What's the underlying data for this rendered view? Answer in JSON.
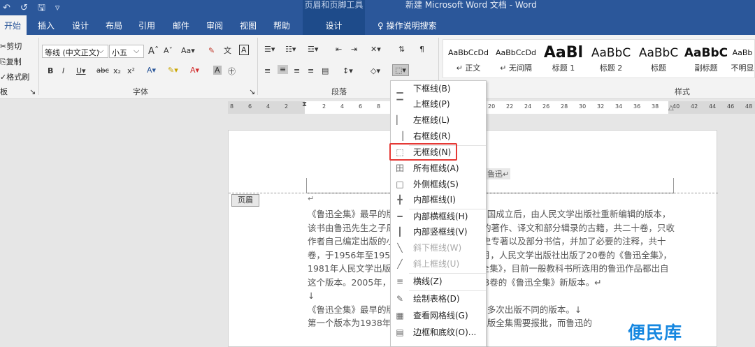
{
  "window": {
    "quick_access": [
      "↶",
      "↺",
      "🖫",
      "▿"
    ],
    "context_title": "页眉和页脚工具",
    "doc_title": "新建 Microsoft Word 文档 - Word"
  },
  "tabs": [
    "开始",
    "插入",
    "设计",
    "布局",
    "引用",
    "邮件",
    "审阅",
    "视图",
    "帮助"
  ],
  "context_tab": "设计",
  "tell_me": "操作说明搜索",
  "clipboard": {
    "cut": "剪切",
    "copy": "复制",
    "painter": "格式刷",
    "label": "板"
  },
  "font": {
    "name": "等线 (中文正文)",
    "size": "小五",
    "label": "字体"
  },
  "paragraph": {
    "label": "段落"
  },
  "styles": {
    "label": "样式",
    "items": [
      {
        "preview": "AaBbCcDd",
        "name": "↵ 正文"
      },
      {
        "preview": "AaBbCcDd",
        "name": "↵ 无间隔"
      },
      {
        "preview": "AaBl",
        "name": "标题 1"
      },
      {
        "preview": "AaBbC",
        "name": "标题 2"
      },
      {
        "preview": "AaBbC",
        "name": "标题"
      },
      {
        "preview": "AaBbC",
        "name": "副标题"
      },
      {
        "preview": "AaBb",
        "name": "不明显"
      }
    ]
  },
  "ruler_numbers": [
    "8",
    "6",
    "4",
    "2",
    "2",
    "4",
    "6",
    "8",
    "20",
    "22",
    "24",
    "26",
    "28",
    "30",
    "32",
    "34",
    "36",
    "38",
    "40",
    "42",
    "44",
    "46",
    "48"
  ],
  "header": {
    "tag": "页眉",
    "header_text": "鲁迅↵",
    "return_mark": "↵"
  },
  "body_paragraphs": [
    "《鲁迅全集》最早的版本为1938年版本。新中国成立后，由人民文学出版社重新编辑的版本，该书由鲁迅先生之子周海婴主编。这只是鲁迅的著作、译文和部分辑录的古籍，共二十卷，只收作者自己编定出版的小说、杂文、评论、文学史专著以及部分书信，并加了必要的注释，共十卷，于1956年至1958年间印行。1973年12月，人民文学出版社出版了20卷的《鲁迅全集》，1981年人民文学出版社出版了16卷的《鲁迅全集》，目前一般教科书所选用的鲁迅作品都出自这个版本。2005年，人民文学出版社出版了18卷的《鲁迅全集》新版本。↵",
    "↓",
    "《鲁迅全集》最早的版本为1938年版本，其后多次出版不同的版本。↓",
    "第一个版本为1938年版本，由于国家体制，出版全集需要报批，而鲁迅的"
  ],
  "border_menu": [
    {
      "glyph": "▁",
      "label": "下框线(B)",
      "disabled": false
    },
    {
      "glyph": "▔",
      "label": "上框线(P)",
      "disabled": false
    },
    {
      "glyph": "▏",
      "label": "左框线(L)",
      "disabled": false
    },
    {
      "glyph": "▕",
      "label": "右框线(R)",
      "disabled": false
    },
    {
      "glyph": "⬚",
      "label": "无框线(N)",
      "disabled": false
    },
    {
      "glyph": "田",
      "label": "所有框线(A)",
      "disabled": false
    },
    {
      "glyph": "□",
      "label": "外侧框线(S)",
      "disabled": false
    },
    {
      "glyph": "╋",
      "label": "内部框线(I)",
      "disabled": false
    },
    {
      "glyph": "━",
      "label": "内部横框线(H)",
      "disabled": false
    },
    {
      "glyph": "┃",
      "label": "内部竖框线(V)",
      "disabled": false
    },
    {
      "glyph": "╲",
      "label": "斜下框线(W)",
      "disabled": true
    },
    {
      "glyph": "╱",
      "label": "斜上框线(U)",
      "disabled": true
    },
    {
      "glyph": "≡",
      "label": "横线(Z)",
      "disabled": false
    },
    {
      "glyph": "✎",
      "label": "绘制表格(D)",
      "disabled": false
    },
    {
      "glyph": "▦",
      "label": "查看网格线(G)",
      "disabled": false
    },
    {
      "glyph": "▤",
      "label": "边框和底纹(O)...",
      "disabled": false
    }
  ],
  "highlighted_item": "无框线(N)",
  "watermark": "便民库",
  "colors": {
    "titlebar": "#2b579a",
    "highlight": "#e53935",
    "watermark": "#1687e0"
  }
}
